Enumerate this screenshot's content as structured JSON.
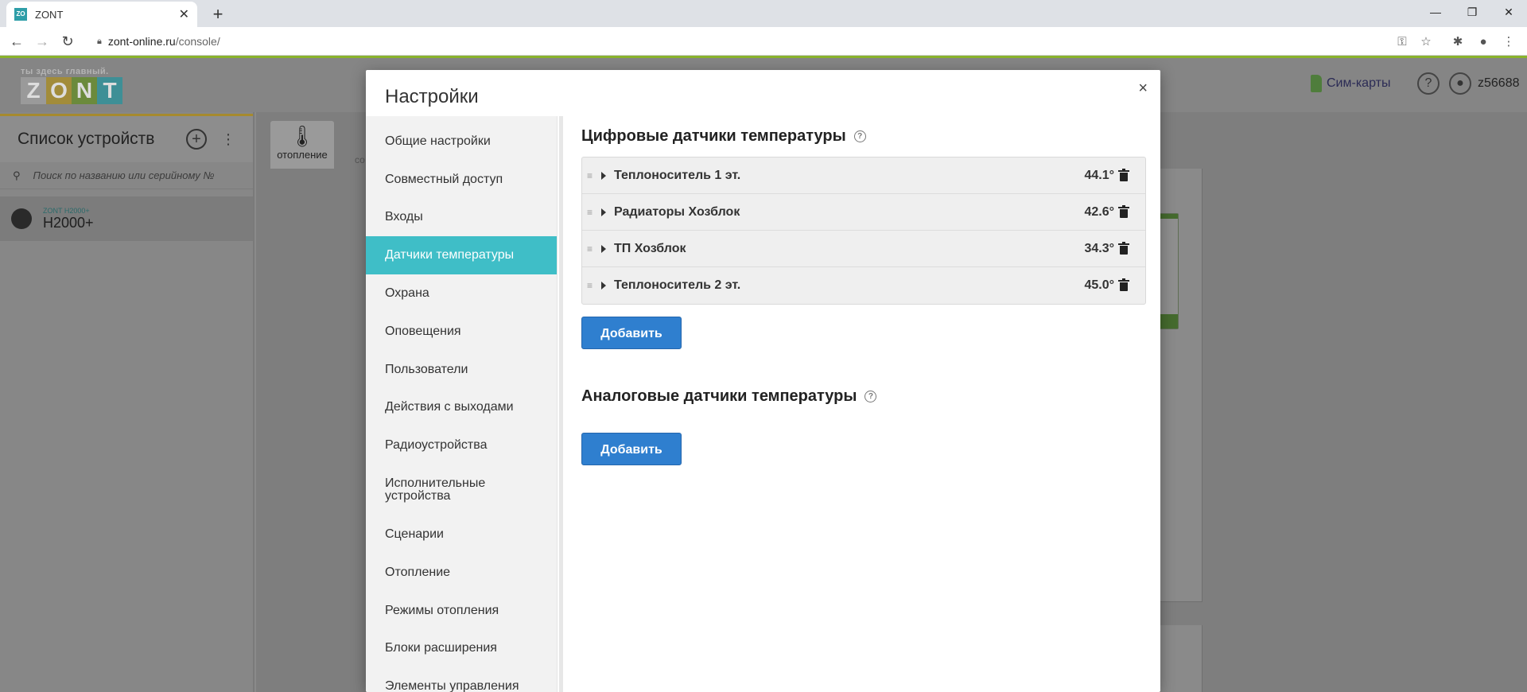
{
  "browser": {
    "tab_title": "ZONT",
    "tab_favicon_text": "ZO\nNT",
    "url_host": "zont-online.ru",
    "url_path": "/console/",
    "username": "z56688"
  },
  "app": {
    "logo_tagline": "ты здесь главный.",
    "logo_letters": [
      "Z",
      "O",
      "N",
      "T"
    ],
    "logo_colors": [
      "#9a9a9a",
      "#a28c3a",
      "#6b8a3c",
      "#3e8f96"
    ],
    "sim_cards_label": "Сим-карты",
    "devices_title": "Список устройств",
    "search_placeholder": "Поиск по названию или серийному №",
    "device": {
      "model": "ZONT H2000+",
      "name": "H2000+"
    },
    "center_tab_label": "отопление",
    "center_tab_label2": "со"
  },
  "modal": {
    "title": "Настройки",
    "close": "×",
    "menu": [
      "Общие настройки",
      "Совместный доступ",
      "Входы",
      "Датчики температуры",
      "Охрана",
      "Оповещения",
      "Пользователи",
      "Действия с выходами",
      "Радиоустройства",
      "Исполнительные устройства",
      "Сценарии",
      "Отопление",
      "Режимы отопления",
      "Блоки расширения",
      "Элементы управления"
    ],
    "active_menu_index": 3,
    "digital_title": "Цифровые датчики температуры",
    "sensors": [
      {
        "name": "Теплоноситель 1 эт.",
        "temp": "44.1°"
      },
      {
        "name": "Радиаторы Хозблок",
        "temp": "42.6°"
      },
      {
        "name": "ТП Хозблок",
        "temp": "34.3°"
      },
      {
        "name": "Теплоноситель 2 эт.",
        "temp": "45.0°"
      }
    ],
    "add_label": "Добавить",
    "analog_title": "Аналоговые датчики температуры",
    "accent_color": "#3fbec7",
    "button_color": "#2f7fcf"
  }
}
